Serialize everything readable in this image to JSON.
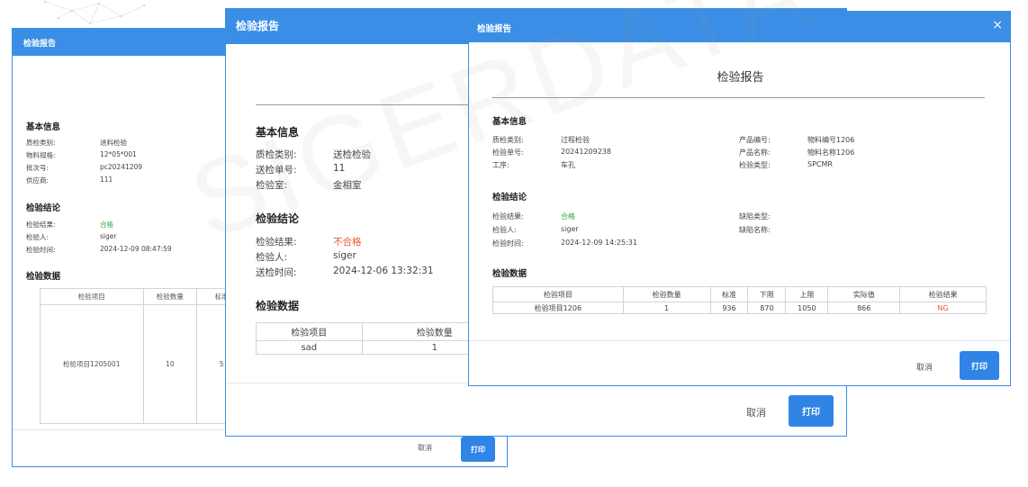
{
  "watermark": "SIGERDATA",
  "dialog_back": {
    "title": "检验报告",
    "basic_info": {
      "heading": "基本信息",
      "rows": [
        {
          "label": "质检类别:",
          "value": "进料检验"
        },
        {
          "label": "物料规格:",
          "value": "12*05*001"
        },
        {
          "label": "批次号:",
          "value": "pc20241209"
        },
        {
          "label": "供应商:",
          "value": "111"
        }
      ]
    },
    "conclusion": {
      "heading": "检验结论",
      "result_label": "检验结果:",
      "result_value": "合格",
      "inspector_label": "检验人:",
      "inspector_value": "siger",
      "time_label": "检验时间:",
      "time_value": "2024-12-09 08:47:59"
    },
    "data": {
      "heading": "检验数据",
      "columns": [
        "检验项目",
        "检验数量",
        "标准"
      ],
      "rows": [
        [
          "检验项目1205001",
          "10",
          "5"
        ]
      ]
    },
    "cancel_label": "取消",
    "print_label": "打印"
  },
  "dialog_middle": {
    "title": "检验报告",
    "basic_info": {
      "heading": "基本信息",
      "rows": [
        {
          "label": "质检类别:",
          "value": "送检检验"
        },
        {
          "label": "送检单号:",
          "value": "11"
        },
        {
          "label": "检验室:",
          "value": "金相室"
        }
      ]
    },
    "conclusion": {
      "heading": "检验结论",
      "result_label": "检验结果:",
      "result_value": "不合格",
      "inspector_label": "检验人:",
      "inspector_value": "siger",
      "time_label": "送检时间:",
      "time_value": "2024-12-06 13:32:31"
    },
    "data": {
      "heading": "检验数据",
      "columns": [
        "检验项目",
        "检验数量"
      ],
      "rows": [
        [
          "sad",
          "1"
        ]
      ]
    },
    "cancel_label": "取消",
    "print_label": "打印"
  },
  "dialog_front": {
    "title": "检验报告",
    "report_title": "检验报告",
    "basic_info": {
      "heading": "基本信息",
      "left": [
        {
          "label": "质检类别:",
          "value": "过程检验"
        },
        {
          "label": "检验单号:",
          "value": "20241209238"
        },
        {
          "label": "工序:",
          "value": "车孔"
        }
      ],
      "right": [
        {
          "label": "产品编号:",
          "value": "物料编号1206"
        },
        {
          "label": "产品名称:",
          "value": "物料名称1206"
        },
        {
          "label": "检验类型:",
          "value": "SPCMR"
        }
      ]
    },
    "conclusion": {
      "heading": "检验结论",
      "result_label": "检验结果:",
      "result_value": "合格",
      "inspector_label": "检验人:",
      "inspector_value": "siger",
      "time_label": "检验时间:",
      "time_value": "2024-12-09 14:25:31",
      "defect_type_label": "缺陷类型:",
      "defect_name_label": "缺陷名称:"
    },
    "data": {
      "heading": "检验数据",
      "columns": [
        "检验项目",
        "检验数量",
        "标准",
        "下限",
        "上限",
        "实际值",
        "检验结果"
      ],
      "rows": [
        [
          "检验项目1206",
          "1",
          "936",
          "870",
          "1050",
          "866",
          "NG"
        ]
      ]
    },
    "cancel_label": "取消",
    "print_label": "打印",
    "close_icon": "×"
  },
  "colors": {
    "header": "#3a8ee6",
    "button": "#2f84e5",
    "pass": "#2eaa4a",
    "fail": "#f0553b"
  }
}
